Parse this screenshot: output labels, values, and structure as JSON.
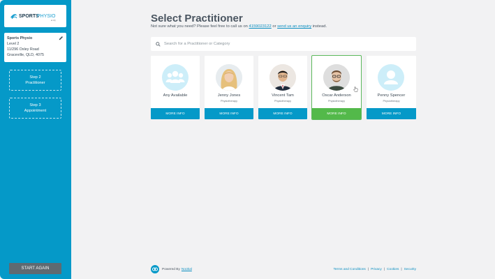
{
  "sidebar": {
    "logo": {
      "text_sports": "SPORTS",
      "text_physio": "PHYSIO",
      "text_small": "at UQ"
    },
    "clinic": {
      "name": "Sports Physio",
      "line1": "Level 2",
      "line2": "11/296 Oxley Road",
      "line3": "Graceville, QLD, 4075"
    },
    "steps": [
      {
        "title": "Step 2",
        "label": "Practitioner"
      },
      {
        "title": "Step 3",
        "label": "Appointment"
      }
    ],
    "start_again_label": "START AGAIN"
  },
  "main": {
    "title": "Select Practitioner",
    "subtitle_prefix": "Not sure what you need? Please feel free to call us on ",
    "phone": "4159023122",
    "subtitle_mid": " or ",
    "enquiry_link": "send us an enquiry",
    "subtitle_suffix": " instead.",
    "search_placeholder": "Search for a Practitioner or Category",
    "practitioners": [
      {
        "name": "Any Available",
        "category": "",
        "more": "MORE INFO",
        "avatar": "group-icon"
      },
      {
        "name": "Jenny Jones",
        "category": "Physiotherapy",
        "more": "MORE INFO",
        "avatar": "photo"
      },
      {
        "name": "Vincent Tam",
        "category": "Physiotherapy",
        "more": "MORE INFO",
        "avatar": "photo"
      },
      {
        "name": "Oscar Anderson",
        "category": "Physiotherapy",
        "more": "MORE INFO",
        "avatar": "photo",
        "selected": true
      },
      {
        "name": "Penny Spencer",
        "category": "Physiotherapy",
        "more": "MORE INFO",
        "avatar": "person-icon"
      }
    ]
  },
  "footer": {
    "powered_by": "Powered By",
    "brand": "Nookal",
    "links": [
      "Terms and Conditions",
      "Privacy",
      "Cookies",
      "Security"
    ],
    "separator": "|"
  },
  "colors": {
    "primary": "#0599c8",
    "selected": "#53b94a",
    "sidebar_button": "#5f6a71"
  }
}
